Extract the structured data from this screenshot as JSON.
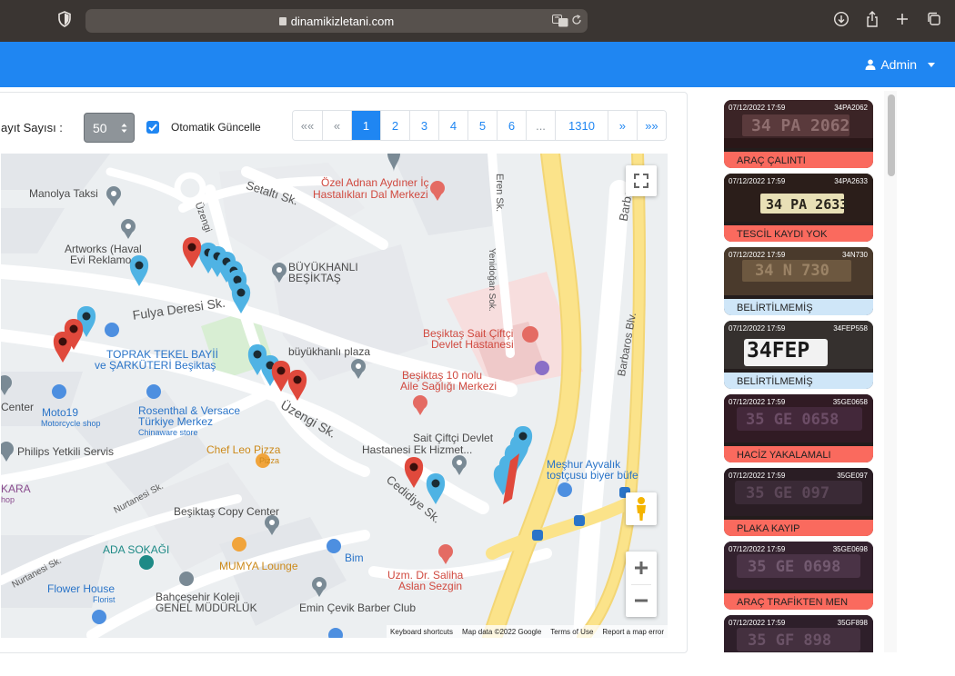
{
  "browser": {
    "url": "dinamikizletani.com"
  },
  "header": {
    "user_label": "Admin"
  },
  "toolbar": {
    "record_count_label": "ayıt Sayısı :",
    "page_size_value": "50",
    "auto_update_label": "Otomatik Güncelle",
    "auto_update_checked": true
  },
  "pagination": {
    "items": [
      "««",
      "«",
      "1",
      "2",
      "3",
      "4",
      "5",
      "6",
      "...",
      "1310",
      "»",
      "»»"
    ],
    "active_page": "1"
  },
  "map": {
    "labels": {
      "manolya": "Manolya Taksi",
      "setalti": "Setaltı Sk.",
      "ozel_adnan_1": "Özel Adnan Aydıner İç",
      "ozel_adnan_2": "Hastalıkları Dal Merkezi",
      "eren": "Eren Sk.",
      "barbaros_top": "Barbaros",
      "artworks_1": "Artworks (Haval",
      "artworks_2": "Evi Reklamo",
      "buyukhanli_1": "BÜYÜKHANLI",
      "buyukhanli_2": "BEŞİKTAŞ",
      "yenidogan": "Yenidoğan Sok.",
      "barbaros_blv": "Barbaros Blv.",
      "fulya": "Fulya Deresi Sk.",
      "toprak_1": "TOPRAK TEKEL BAYİİ",
      "toprak_2": "ve ŞARKÜTERİ Beşiktaş",
      "buyukhanli_plaza": "büyükhanlı plaza",
      "sait_ciftci_1": "Beşiktaş Sait Çiftçi",
      "sait_ciftci_2": "Devlet Hastanesi",
      "asm_1": "Beşiktaş 10 nolu",
      "asm_2": "Aile Sağlığı Merkezi",
      "center": "Center",
      "moto19": "Moto19",
      "moto19_sub": "Motorcycle shop",
      "rosenthal_1": "Rosenthal & Versace",
      "rosenthal_2": "Türkiye Merkez",
      "rosenthal_sub": "Chinaware store",
      "uzengi": "Üzengi Sk.",
      "sait_ek_1": "Sait Çiftçi Devlet",
      "sait_ek_2": "Hastanesi Ek Hizmet...",
      "philips": "Philips Yetkili Servis",
      "chef_leo": "Chef Leo Pizza",
      "chef_leo_sub": "Pizza",
      "meshur_1": "Meşhur Ayvalık",
      "meshur_2": "tostçusu biyer büfe",
      "kara": "KARA",
      "kara_sub": "hop",
      "nurtanesi_1": "Nurtanesi Sk.",
      "cedidiye": "Cedidiye Sk.",
      "copy_center": "Beşiktaş Copy Center",
      "ada": "ADA SOKAĞI",
      "bim": "Bim",
      "mumya": "MUMYA Lounge",
      "nurtanesi_2": "Nurtanesi Sk.",
      "saliha_1": "Uzm. Dr. Saliha",
      "saliha_2": "Aslan Sezgin",
      "flower": "Flower House",
      "flower_sub": "Florist",
      "bahcesehir_1": "Bahçeşehir Koleji",
      "bahcesehir_2": "GENEL MÜDÜRLÜK",
      "emin": "Emin Çevik Barber Club",
      "uzengi_vertical": "Üzengi"
    },
    "attribution": {
      "shortcuts": "Keyboard shortcuts",
      "data": "Map data ©2022 Google",
      "terms": "Terms of Use",
      "report": "Report a map error"
    }
  },
  "plates": [
    {
      "time": "07/12/2022 17:59",
      "plate": "34PA2062",
      "status": "ARAÇ ÇALINTI",
      "status_color": "#fa6a5e",
      "reading": "34 PA 2062"
    },
    {
      "time": "07/12/2022 17:59",
      "plate": "34PA2633",
      "status": "TESCİL KAYDI YOK",
      "status_color": "#fa6a5e",
      "reading": "34 PA 2633"
    },
    {
      "time": "07/12/2022 17:59",
      "plate": "34N730",
      "status": "BELİRTİLMEMİŞ",
      "status_color": "#cfe6f8",
      "reading": "34 N 730"
    },
    {
      "time": "07/12/2022 17:59",
      "plate": "34FEP558",
      "status": "BELİRTİLMEMİŞ",
      "status_color": "#cfe6f8",
      "reading": "34FEP"
    },
    {
      "time": "07/12/2022 17:59",
      "plate": "35GE0658",
      "status": "HACİZ YAKALAMALI",
      "status_color": "#fa6a5e",
      "reading": "35 GE 0658"
    },
    {
      "time": "07/12/2022 17:59",
      "plate": "35GE097",
      "status": "PLAKA KAYIP",
      "status_color": "#fa6a5e",
      "reading": "35 GE 097"
    },
    {
      "time": "07/12/2022 17:59",
      "plate": "35GE0698",
      "status": "ARAÇ TRAFİKTEN MEN",
      "status_color": "#fa6a5e",
      "reading": "35 GE 0698"
    },
    {
      "time": "07/12/2022 17:59",
      "plate": "35GF898",
      "status": "",
      "status_color": "#fa6a5e",
      "reading": "35 GF 898"
    }
  ],
  "colors": {
    "brand_blue": "#1f86f2",
    "marker_red": "#e0493c",
    "marker_blue": "#4fb3e4",
    "alert_red": "#fa6a5e",
    "info_blue": "#cfe6f8"
  }
}
